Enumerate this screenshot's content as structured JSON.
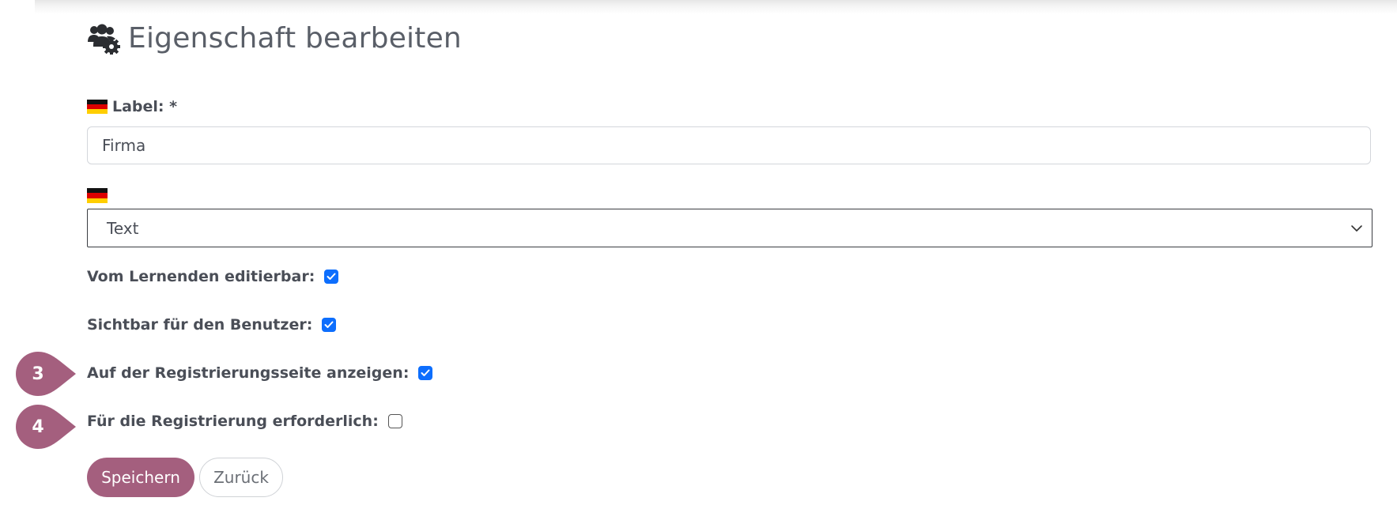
{
  "header": {
    "icon": "users-gear-icon",
    "title": "Eigenschaft bearbeiten"
  },
  "form": {
    "label_field": {
      "flag": "german-flag-icon",
      "label": "Label: *",
      "value": "Firma"
    },
    "type_field": {
      "flag": "german-flag-icon",
      "selected": "Text"
    },
    "checkboxes": [
      {
        "label": "Vom Lernenden editierbar:",
        "checked": true
      },
      {
        "label": "Sichtbar für den Benutzer:",
        "checked": true
      },
      {
        "label": "Auf der Registrierungsseite anzeigen:",
        "checked": true
      },
      {
        "label": "Für die Registrierung erforderlich:",
        "checked": false
      }
    ]
  },
  "markers": [
    {
      "number": "3"
    },
    {
      "number": "4"
    }
  ],
  "buttons": {
    "save": "Speichern",
    "back": "Zurück"
  },
  "colors": {
    "accent": "#a45f7e",
    "checkbox": "#0d6efd",
    "text": "#4a4e57"
  }
}
